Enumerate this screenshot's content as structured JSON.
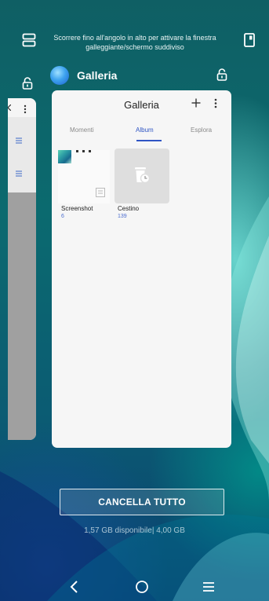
{
  "hint": {
    "text": "Scorrere fino all'angolo in alto per attivare la finestra galleggiante/schermo suddiviso"
  },
  "icons": {
    "split_screen": "split-screen-icon",
    "floating_window": "floating-window-icon",
    "lock": "lock-icon"
  },
  "app": {
    "name": "Galleria"
  },
  "gallery": {
    "title": "Galleria",
    "tabs": [
      "Momenti",
      "Album",
      "Esplora"
    ],
    "active_tab": "Album",
    "albums": [
      {
        "name": "Screenshot",
        "count": "6"
      },
      {
        "name": "Cestino",
        "count": "139"
      }
    ]
  },
  "actions": {
    "clear_all": "CANCELLA TUTTO"
  },
  "memory": {
    "text": "1,57 GB disponibile| 4,00 GB"
  },
  "colors": {
    "accent": "#2f55c4",
    "count_blue": "#4e6fd0"
  }
}
